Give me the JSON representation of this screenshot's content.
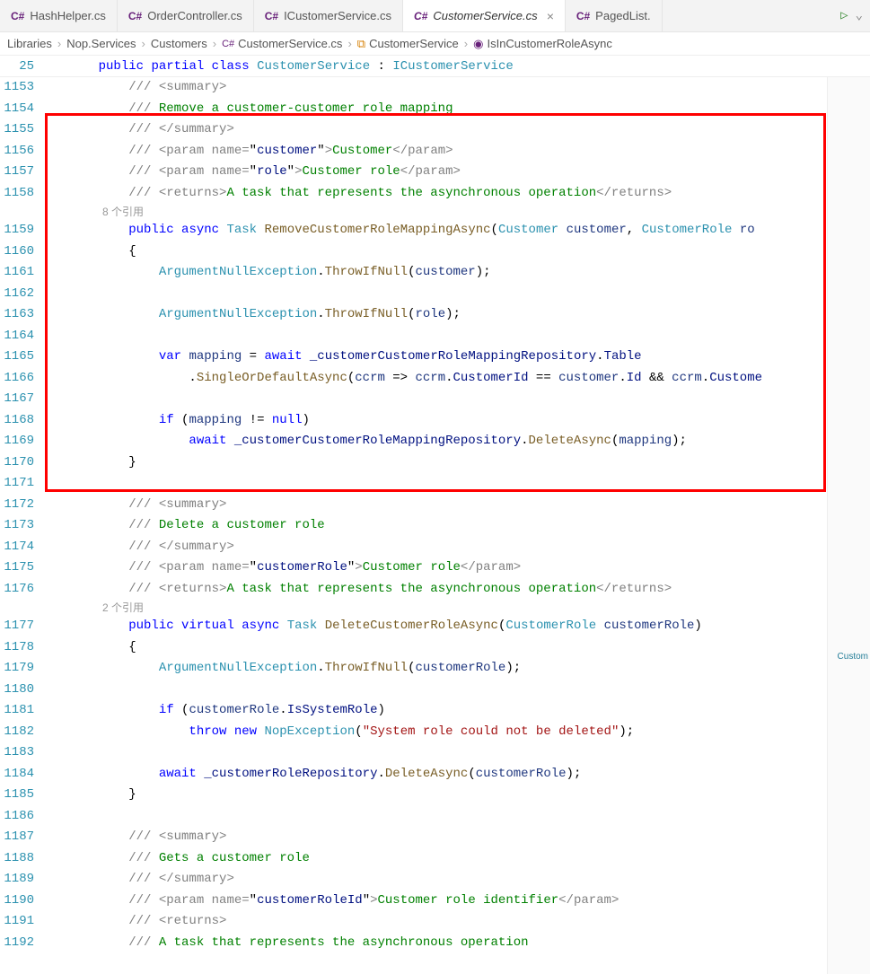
{
  "tabs": [
    {
      "name": "HashHelper.cs",
      "active": false
    },
    {
      "name": "OrderController.cs",
      "active": false
    },
    {
      "name": "ICustomerService.cs",
      "active": false
    },
    {
      "name": "CustomerService.cs",
      "active": true
    },
    {
      "name": "PagedList.",
      "active": false
    }
  ],
  "breadcrumbs": {
    "parts": [
      "Libraries",
      "Nop.Services",
      "Customers",
      "CustomerService.cs",
      "CustomerService",
      "IsInCustomerRoleAsync"
    ]
  },
  "sticky": {
    "line_no": "25",
    "tokens": [
      {
        "t": "    ",
        "c": "plain"
      },
      {
        "t": "public",
        "c": "kw"
      },
      {
        "t": " ",
        "c": "plain"
      },
      {
        "t": "partial",
        "c": "kw"
      },
      {
        "t": " ",
        "c": "plain"
      },
      {
        "t": "class",
        "c": "kw"
      },
      {
        "t": " ",
        "c": "plain"
      },
      {
        "t": "CustomerService",
        "c": "type"
      },
      {
        "t": " : ",
        "c": "plain"
      },
      {
        "t": "ICustomerService",
        "c": "type"
      }
    ]
  },
  "codelens": {
    "ref1": "8 个引用",
    "ref2": "2 个引用"
  },
  "minimap_label": "Custom",
  "lines": [
    {
      "n": "1153",
      "tokens": [
        {
          "t": "        ",
          "c": "plain"
        },
        {
          "t": "/// ",
          "c": "cmt-tag"
        },
        {
          "t": "<summary>",
          "c": "cmt-tag"
        }
      ]
    },
    {
      "n": "1154",
      "tokens": [
        {
          "t": "        ",
          "c": "plain"
        },
        {
          "t": "/// ",
          "c": "cmt-tag"
        },
        {
          "t": "Remove a customer-customer role mapping",
          "c": "cmt"
        }
      ]
    },
    {
      "n": "1155",
      "tokens": [
        {
          "t": "        ",
          "c": "plain"
        },
        {
          "t": "/// ",
          "c": "cmt-tag"
        },
        {
          "t": "</summary>",
          "c": "cmt-tag"
        }
      ]
    },
    {
      "n": "1156",
      "tokens": [
        {
          "t": "        ",
          "c": "plain"
        },
        {
          "t": "/// ",
          "c": "cmt-tag"
        },
        {
          "t": "<param name=",
          "c": "cmt-tag"
        },
        {
          "t": "\"",
          "c": "plain"
        },
        {
          "t": "customer",
          "c": "ident"
        },
        {
          "t": "\"",
          "c": "plain"
        },
        {
          "t": ">",
          "c": "cmt-tag"
        },
        {
          "t": "Customer",
          "c": "cmt"
        },
        {
          "t": "</param>",
          "c": "cmt-tag"
        }
      ]
    },
    {
      "n": "1157",
      "tokens": [
        {
          "t": "        ",
          "c": "plain"
        },
        {
          "t": "/// ",
          "c": "cmt-tag"
        },
        {
          "t": "<param name=",
          "c": "cmt-tag"
        },
        {
          "t": "\"",
          "c": "plain"
        },
        {
          "t": "role",
          "c": "ident"
        },
        {
          "t": "\"",
          "c": "plain"
        },
        {
          "t": ">",
          "c": "cmt-tag"
        },
        {
          "t": "Customer role",
          "c": "cmt"
        },
        {
          "t": "</param>",
          "c": "cmt-tag"
        }
      ]
    },
    {
      "n": "1158",
      "tokens": [
        {
          "t": "        ",
          "c": "plain"
        },
        {
          "t": "/// ",
          "c": "cmt-tag"
        },
        {
          "t": "<returns>",
          "c": "cmt-tag"
        },
        {
          "t": "A task that represents the asynchronous operation",
          "c": "cmt"
        },
        {
          "t": "</returns>",
          "c": "cmt-tag"
        }
      ]
    },
    {
      "n": "",
      "codelens": "ref1"
    },
    {
      "n": "1159",
      "tokens": [
        {
          "t": "        ",
          "c": "plain"
        },
        {
          "t": "public",
          "c": "kw"
        },
        {
          "t": " ",
          "c": "plain"
        },
        {
          "t": "async",
          "c": "kw"
        },
        {
          "t": " ",
          "c": "plain"
        },
        {
          "t": "Task",
          "c": "type"
        },
        {
          "t": " ",
          "c": "plain"
        },
        {
          "t": "RemoveCustomerRoleMappingAsync",
          "c": "method"
        },
        {
          "t": "(",
          "c": "plain"
        },
        {
          "t": "Customer",
          "c": "type"
        },
        {
          "t": " ",
          "c": "plain"
        },
        {
          "t": "customer",
          "c": "local"
        },
        {
          "t": ", ",
          "c": "plain"
        },
        {
          "t": "CustomerRole",
          "c": "type"
        },
        {
          "t": " ",
          "c": "plain"
        },
        {
          "t": "ro",
          "c": "local"
        }
      ]
    },
    {
      "n": "1160",
      "tokens": [
        {
          "t": "        {",
          "c": "plain"
        }
      ]
    },
    {
      "n": "1161",
      "tokens": [
        {
          "t": "            ",
          "c": "plain"
        },
        {
          "t": "ArgumentNullException",
          "c": "type"
        },
        {
          "t": ".",
          "c": "plain"
        },
        {
          "t": "ThrowIfNull",
          "c": "method"
        },
        {
          "t": "(",
          "c": "plain"
        },
        {
          "t": "customer",
          "c": "local"
        },
        {
          "t": ");",
          "c": "plain"
        }
      ]
    },
    {
      "n": "1162",
      "tokens": [
        {
          "t": "",
          "c": "plain"
        }
      ]
    },
    {
      "n": "1163",
      "tokens": [
        {
          "t": "            ",
          "c": "plain"
        },
        {
          "t": "ArgumentNullException",
          "c": "type"
        },
        {
          "t": ".",
          "c": "plain"
        },
        {
          "t": "ThrowIfNull",
          "c": "method"
        },
        {
          "t": "(",
          "c": "plain"
        },
        {
          "t": "role",
          "c": "local"
        },
        {
          "t": ");",
          "c": "plain"
        }
      ]
    },
    {
      "n": "1164",
      "tokens": [
        {
          "t": "",
          "c": "plain"
        }
      ]
    },
    {
      "n": "1165",
      "tokens": [
        {
          "t": "            ",
          "c": "plain"
        },
        {
          "t": "var",
          "c": "kw"
        },
        {
          "t": " ",
          "c": "plain"
        },
        {
          "t": "mapping",
          "c": "local"
        },
        {
          "t": " = ",
          "c": "plain"
        },
        {
          "t": "await",
          "c": "kw"
        },
        {
          "t": " ",
          "c": "plain"
        },
        {
          "t": "_customerCustomerRoleMappingRepository",
          "c": "ident"
        },
        {
          "t": ".",
          "c": "plain"
        },
        {
          "t": "Table",
          "c": "ident"
        }
      ]
    },
    {
      "n": "1166",
      "tokens": [
        {
          "t": "                .",
          "c": "plain"
        },
        {
          "t": "SingleOrDefaultAsync",
          "c": "method"
        },
        {
          "t": "(",
          "c": "plain"
        },
        {
          "t": "ccrm",
          "c": "local"
        },
        {
          "t": " => ",
          "c": "plain"
        },
        {
          "t": "ccrm",
          "c": "local"
        },
        {
          "t": ".",
          "c": "plain"
        },
        {
          "t": "CustomerId",
          "c": "ident"
        },
        {
          "t": " == ",
          "c": "plain"
        },
        {
          "t": "customer",
          "c": "local"
        },
        {
          "t": ".",
          "c": "plain"
        },
        {
          "t": "Id",
          "c": "ident"
        },
        {
          "t": " && ",
          "c": "plain"
        },
        {
          "t": "ccrm",
          "c": "local"
        },
        {
          "t": ".",
          "c": "plain"
        },
        {
          "t": "Custome",
          "c": "ident"
        }
      ]
    },
    {
      "n": "1167",
      "tokens": [
        {
          "t": "",
          "c": "plain"
        }
      ]
    },
    {
      "n": "1168",
      "tokens": [
        {
          "t": "            ",
          "c": "plain"
        },
        {
          "t": "if",
          "c": "kw"
        },
        {
          "t": " (",
          "c": "plain"
        },
        {
          "t": "mapping",
          "c": "local"
        },
        {
          "t": " != ",
          "c": "plain"
        },
        {
          "t": "null",
          "c": "kw"
        },
        {
          "t": ")",
          "c": "plain"
        }
      ]
    },
    {
      "n": "1169",
      "tokens": [
        {
          "t": "                ",
          "c": "plain"
        },
        {
          "t": "await",
          "c": "kw"
        },
        {
          "t": " ",
          "c": "plain"
        },
        {
          "t": "_customerCustomerRoleMappingRepository",
          "c": "ident"
        },
        {
          "t": ".",
          "c": "plain"
        },
        {
          "t": "DeleteAsync",
          "c": "method"
        },
        {
          "t": "(",
          "c": "plain"
        },
        {
          "t": "mapping",
          "c": "local"
        },
        {
          "t": ");",
          "c": "plain"
        }
      ]
    },
    {
      "n": "1170",
      "tokens": [
        {
          "t": "        }",
          "c": "plain"
        }
      ]
    },
    {
      "n": "1171",
      "tokens": [
        {
          "t": "",
          "c": "plain"
        }
      ]
    },
    {
      "n": "1172",
      "tokens": [
        {
          "t": "        ",
          "c": "plain"
        },
        {
          "t": "/// ",
          "c": "cmt-tag"
        },
        {
          "t": "<summary>",
          "c": "cmt-tag"
        }
      ]
    },
    {
      "n": "1173",
      "tokens": [
        {
          "t": "        ",
          "c": "plain"
        },
        {
          "t": "/// ",
          "c": "cmt-tag"
        },
        {
          "t": "Delete a customer role",
          "c": "cmt"
        }
      ]
    },
    {
      "n": "1174",
      "tokens": [
        {
          "t": "        ",
          "c": "plain"
        },
        {
          "t": "/// ",
          "c": "cmt-tag"
        },
        {
          "t": "</summary>",
          "c": "cmt-tag"
        }
      ]
    },
    {
      "n": "1175",
      "tokens": [
        {
          "t": "        ",
          "c": "plain"
        },
        {
          "t": "/// ",
          "c": "cmt-tag"
        },
        {
          "t": "<param name=",
          "c": "cmt-tag"
        },
        {
          "t": "\"",
          "c": "plain"
        },
        {
          "t": "customerRole",
          "c": "ident"
        },
        {
          "t": "\"",
          "c": "plain"
        },
        {
          "t": ">",
          "c": "cmt-tag"
        },
        {
          "t": "Customer role",
          "c": "cmt"
        },
        {
          "t": "</param>",
          "c": "cmt-tag"
        }
      ]
    },
    {
      "n": "1176",
      "tokens": [
        {
          "t": "        ",
          "c": "plain"
        },
        {
          "t": "/// ",
          "c": "cmt-tag"
        },
        {
          "t": "<returns>",
          "c": "cmt-tag"
        },
        {
          "t": "A task that represents the asynchronous operation",
          "c": "cmt"
        },
        {
          "t": "</returns>",
          "c": "cmt-tag"
        }
      ]
    },
    {
      "n": "",
      "codelens": "ref2"
    },
    {
      "n": "1177",
      "tokens": [
        {
          "t": "        ",
          "c": "plain"
        },
        {
          "t": "public",
          "c": "kw"
        },
        {
          "t": " ",
          "c": "plain"
        },
        {
          "t": "virtual",
          "c": "kw"
        },
        {
          "t": " ",
          "c": "plain"
        },
        {
          "t": "async",
          "c": "kw"
        },
        {
          "t": " ",
          "c": "plain"
        },
        {
          "t": "Task",
          "c": "type"
        },
        {
          "t": " ",
          "c": "plain"
        },
        {
          "t": "DeleteCustomerRoleAsync",
          "c": "method"
        },
        {
          "t": "(",
          "c": "plain"
        },
        {
          "t": "CustomerRole",
          "c": "type"
        },
        {
          "t": " ",
          "c": "plain"
        },
        {
          "t": "customerRole",
          "c": "local"
        },
        {
          "t": ")",
          "c": "plain"
        }
      ]
    },
    {
      "n": "1178",
      "tokens": [
        {
          "t": "        {",
          "c": "plain"
        }
      ]
    },
    {
      "n": "1179",
      "tokens": [
        {
          "t": "            ",
          "c": "plain"
        },
        {
          "t": "ArgumentNullException",
          "c": "type"
        },
        {
          "t": ".",
          "c": "plain"
        },
        {
          "t": "ThrowIfNull",
          "c": "method"
        },
        {
          "t": "(",
          "c": "plain"
        },
        {
          "t": "customerRole",
          "c": "local"
        },
        {
          "t": ");",
          "c": "plain"
        }
      ]
    },
    {
      "n": "1180",
      "tokens": [
        {
          "t": "",
          "c": "plain"
        }
      ]
    },
    {
      "n": "1181",
      "tokens": [
        {
          "t": "            ",
          "c": "plain"
        },
        {
          "t": "if",
          "c": "kw"
        },
        {
          "t": " (",
          "c": "plain"
        },
        {
          "t": "customerRole",
          "c": "local"
        },
        {
          "t": ".",
          "c": "plain"
        },
        {
          "t": "IsSystemRole",
          "c": "ident"
        },
        {
          "t": ")",
          "c": "plain"
        }
      ]
    },
    {
      "n": "1182",
      "tokens": [
        {
          "t": "                ",
          "c": "plain"
        },
        {
          "t": "throw",
          "c": "kw"
        },
        {
          "t": " ",
          "c": "plain"
        },
        {
          "t": "new",
          "c": "kw"
        },
        {
          "t": " ",
          "c": "plain"
        },
        {
          "t": "NopException",
          "c": "type"
        },
        {
          "t": "(",
          "c": "plain"
        },
        {
          "t": "\"System role could not be deleted\"",
          "c": "str"
        },
        {
          "t": ");",
          "c": "plain"
        }
      ]
    },
    {
      "n": "1183",
      "tokens": [
        {
          "t": "",
          "c": "plain"
        }
      ]
    },
    {
      "n": "1184",
      "tokens": [
        {
          "t": "            ",
          "c": "plain"
        },
        {
          "t": "await",
          "c": "kw"
        },
        {
          "t": " ",
          "c": "plain"
        },
        {
          "t": "_customerRoleRepository",
          "c": "ident"
        },
        {
          "t": ".",
          "c": "plain"
        },
        {
          "t": "DeleteAsync",
          "c": "method"
        },
        {
          "t": "(",
          "c": "plain"
        },
        {
          "t": "customerRole",
          "c": "local"
        },
        {
          "t": ");",
          "c": "plain"
        }
      ]
    },
    {
      "n": "1185",
      "tokens": [
        {
          "t": "        }",
          "c": "plain"
        }
      ]
    },
    {
      "n": "1186",
      "tokens": [
        {
          "t": "",
          "c": "plain"
        }
      ]
    },
    {
      "n": "1187",
      "tokens": [
        {
          "t": "        ",
          "c": "plain"
        },
        {
          "t": "/// ",
          "c": "cmt-tag"
        },
        {
          "t": "<summary>",
          "c": "cmt-tag"
        }
      ]
    },
    {
      "n": "1188",
      "tokens": [
        {
          "t": "        ",
          "c": "plain"
        },
        {
          "t": "/// ",
          "c": "cmt-tag"
        },
        {
          "t": "Gets a customer role",
          "c": "cmt"
        }
      ]
    },
    {
      "n": "1189",
      "tokens": [
        {
          "t": "        ",
          "c": "plain"
        },
        {
          "t": "/// ",
          "c": "cmt-tag"
        },
        {
          "t": "</summary>",
          "c": "cmt-tag"
        }
      ]
    },
    {
      "n": "1190",
      "tokens": [
        {
          "t": "        ",
          "c": "plain"
        },
        {
          "t": "/// ",
          "c": "cmt-tag"
        },
        {
          "t": "<param name=",
          "c": "cmt-tag"
        },
        {
          "t": "\"",
          "c": "plain"
        },
        {
          "t": "customerRoleId",
          "c": "ident"
        },
        {
          "t": "\"",
          "c": "plain"
        },
        {
          "t": ">",
          "c": "cmt-tag"
        },
        {
          "t": "Customer role identifier",
          "c": "cmt"
        },
        {
          "t": "</param>",
          "c": "cmt-tag"
        }
      ]
    },
    {
      "n": "1191",
      "tokens": [
        {
          "t": "        ",
          "c": "plain"
        },
        {
          "t": "/// ",
          "c": "cmt-tag"
        },
        {
          "t": "<returns>",
          "c": "cmt-tag"
        }
      ]
    },
    {
      "n": "1192",
      "tokens": [
        {
          "t": "        ",
          "c": "plain"
        },
        {
          "t": "/// ",
          "c": "cmt-tag"
        },
        {
          "t": "A task that represents the asynchronous operation",
          "c": "cmt"
        }
      ]
    }
  ]
}
